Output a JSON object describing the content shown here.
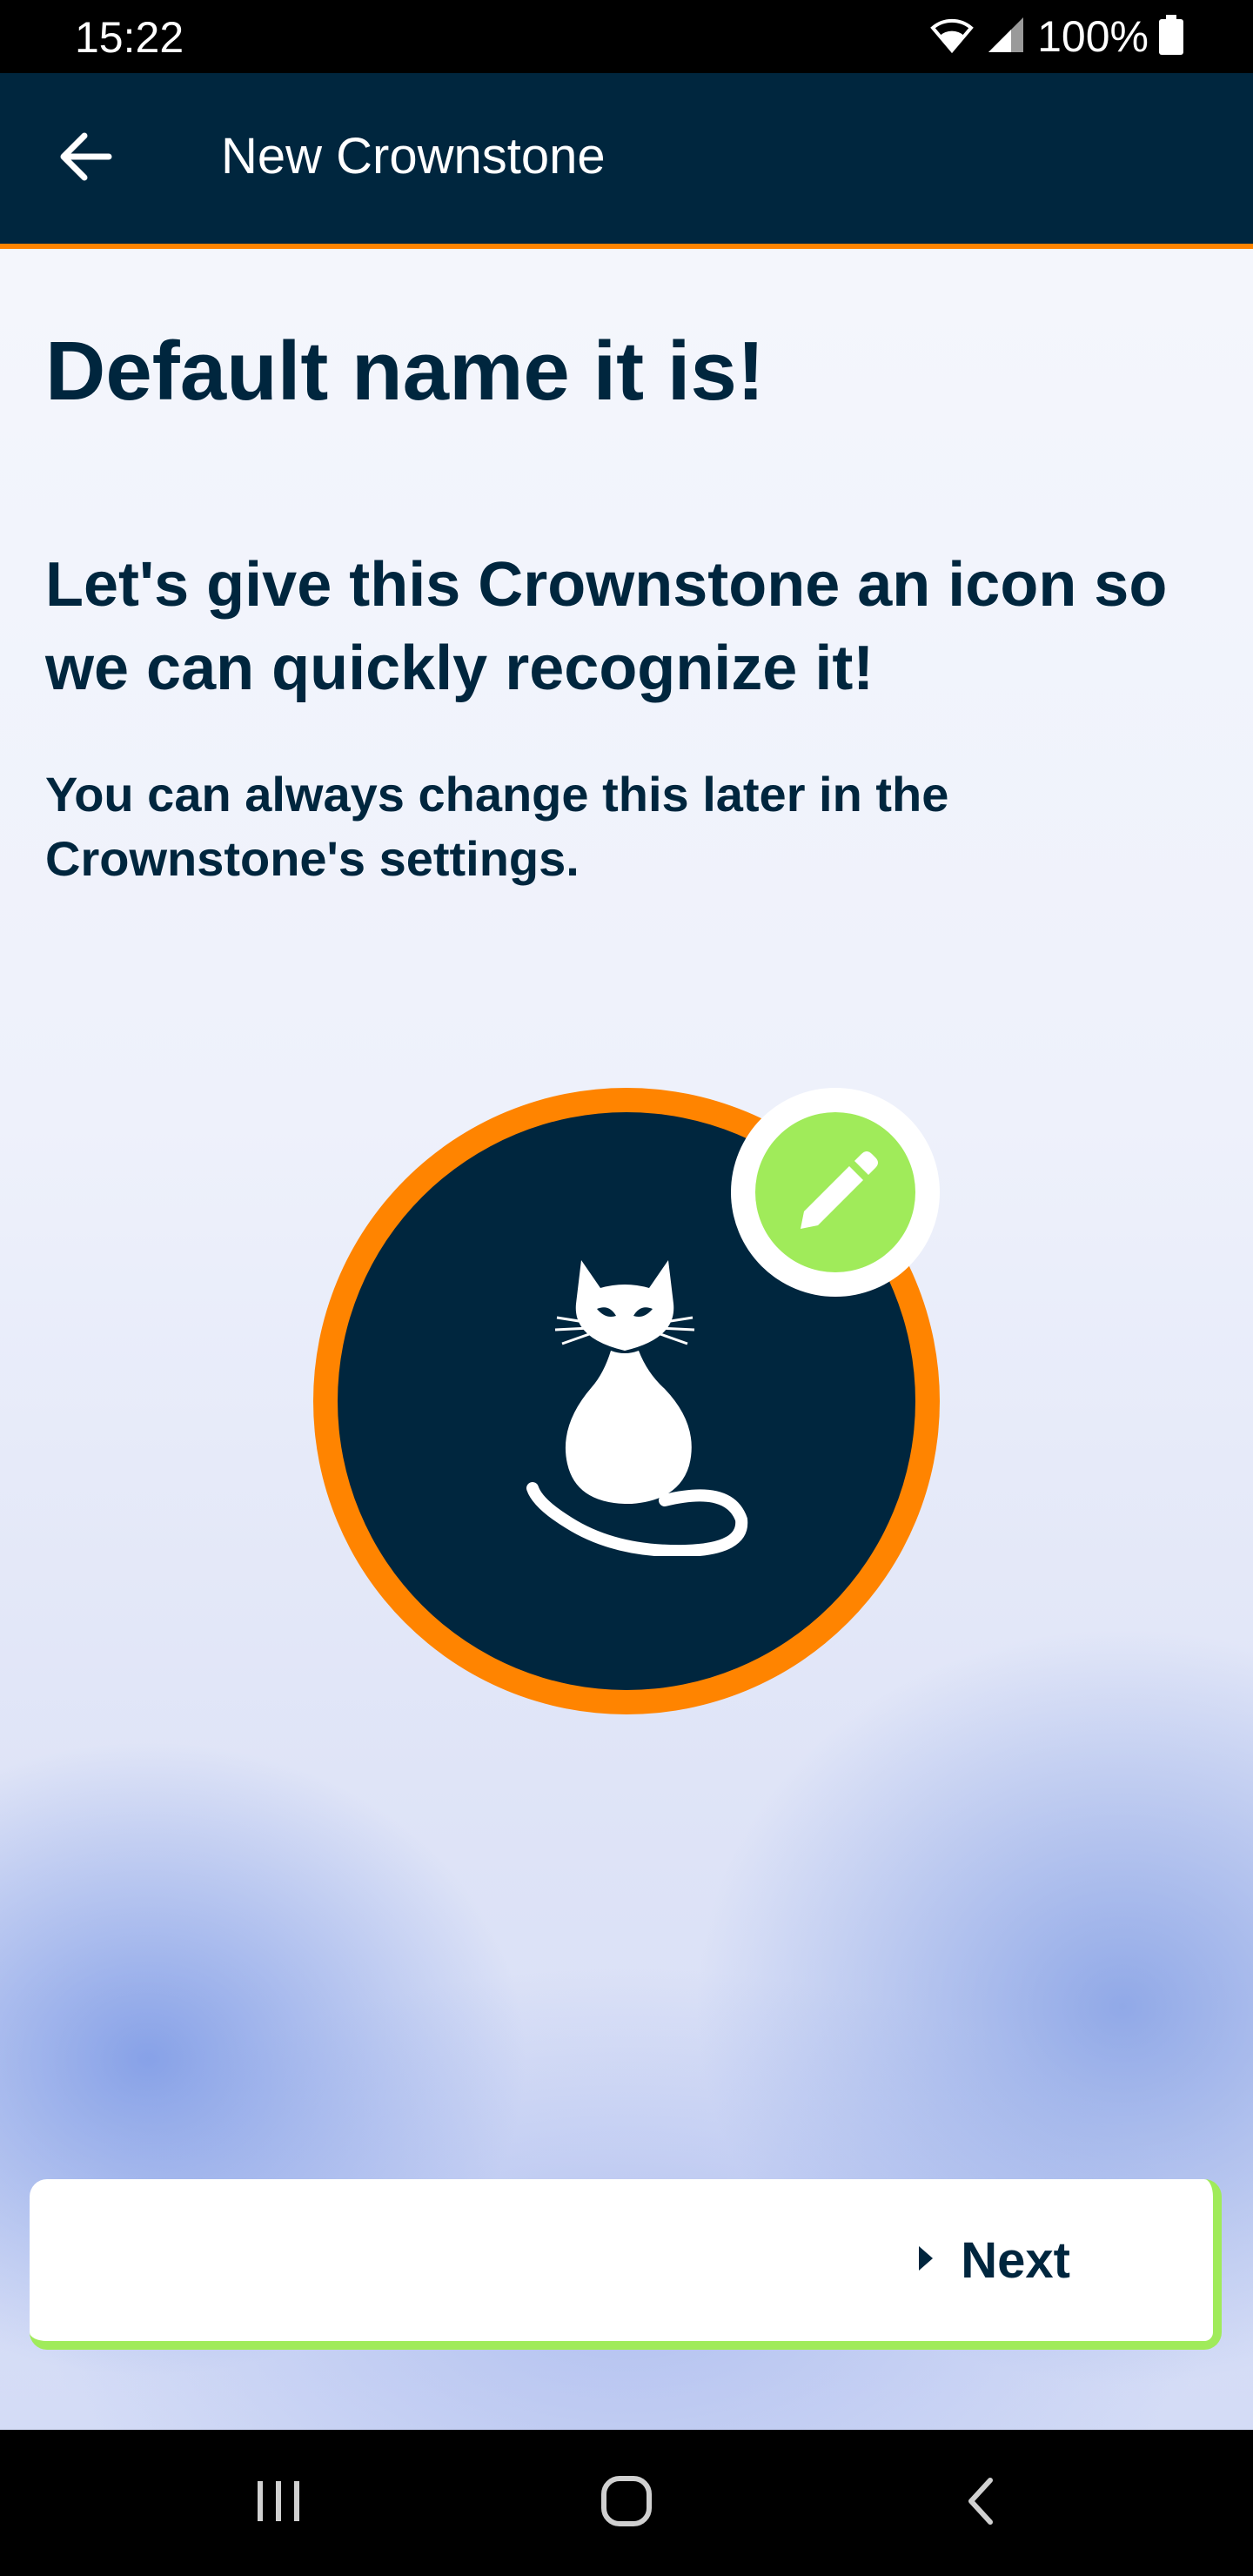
{
  "status_bar": {
    "time": "15:22",
    "battery": "100%",
    "icons": [
      "wifi-icon",
      "cell-signal-icon",
      "battery-icon"
    ]
  },
  "header": {
    "back_icon": "arrow-left-icon",
    "title": "New Crownstone",
    "background_color": "#00263e",
    "accent_color": "#ff8400"
  },
  "main": {
    "heading": "Default name it is!",
    "subheading": "Let's give this Crownstone an icon so we can quickly recognize it!",
    "body": "You can always change this later in the Crownstone's settings.",
    "selected_icon": "cat-icon",
    "edit_icon": "pencil-icon",
    "ring_color": "#ff8400",
    "edit_badge_color": "#a0eb5a"
  },
  "footer": {
    "next_label": "Next",
    "next_icon": "caret-right-icon",
    "next_border_color": "#a0eb5a"
  },
  "nav_bar": {
    "buttons": [
      "recent-apps-icon",
      "home-icon",
      "back-icon"
    ]
  }
}
